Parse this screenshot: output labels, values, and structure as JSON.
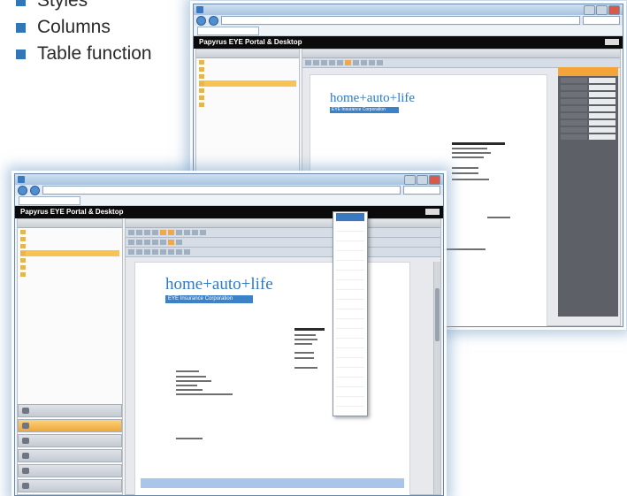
{
  "bullets": [
    {
      "label": "Styles"
    },
    {
      "label": "Columns"
    },
    {
      "label": "Table function"
    }
  ],
  "app": {
    "portal_title": "Papyrus EYE Portal & Desktop",
    "logo_main": "home+auto+life",
    "logo_band": "EYE Insurance Corporation"
  },
  "colors": {
    "bullet": "#2f77b9",
    "accent_orange": "#f3a53a",
    "portal_bar": "#0b0b0b",
    "logo_blue": "#2f7ac4"
  },
  "icons": {
    "bullet_marker": "square-bullet",
    "browser": "ie-icon",
    "folder": "folder-icon"
  }
}
